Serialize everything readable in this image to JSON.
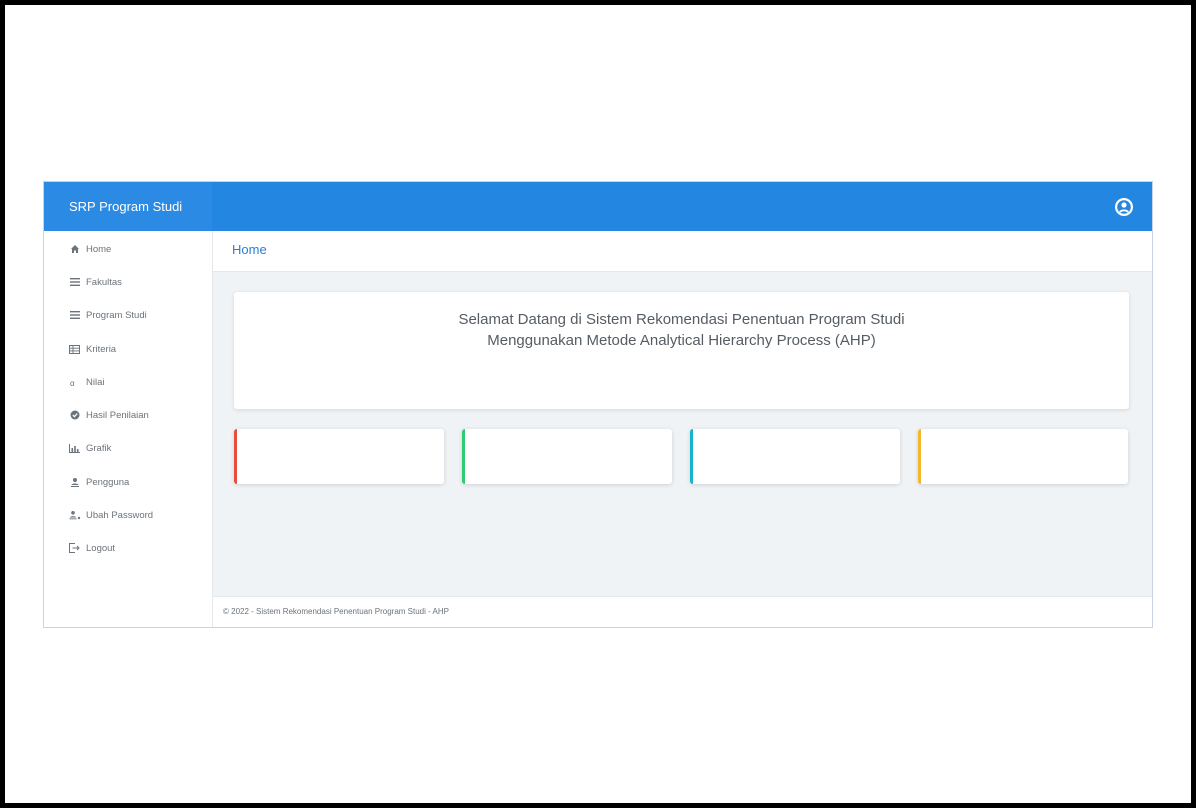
{
  "app": {
    "brand": "SRP Program Studi"
  },
  "sidebar": {
    "items": [
      {
        "label": "Home",
        "icon": "home-icon"
      },
      {
        "label": "Fakultas",
        "icon": "list-icon"
      },
      {
        "label": "Program Studi",
        "icon": "list-icon"
      },
      {
        "label": "Kriteria",
        "icon": "table-icon"
      },
      {
        "label": "Nilai",
        "icon": "sort-icon"
      },
      {
        "label": "Hasil Penilaian",
        "icon": "check-circle-icon"
      },
      {
        "label": "Grafik",
        "icon": "bar-chart-icon"
      },
      {
        "label": "Pengguna",
        "icon": "user-icon"
      },
      {
        "label": "Ubah Password",
        "icon": "user-key-icon"
      },
      {
        "label": "Logout",
        "icon": "logout-icon"
      }
    ]
  },
  "breadcrumb": {
    "current": "Home"
  },
  "welcome": {
    "line1": "Selamat Datang di Sistem Rekomendasi Penentuan Program Studi",
    "line2": "Menggunakan Metode Analytical Hierarchy Process (AHP)"
  },
  "stat_cards": [
    {
      "accent": "#e74c3c"
    },
    {
      "accent": "#2ecc71"
    },
    {
      "accent": "#17b2cc"
    },
    {
      "accent": "#f1b82d"
    }
  ],
  "footer": {
    "text": "© 2022 - Sistem Rekomendasi Penentuan Program Studi - AHP"
  },
  "colors": {
    "topbar": "#2386e0",
    "brand_bg": "#2b8ae4",
    "breadcrumb_text": "#2a7fd4",
    "content_bg": "#f0f3f5"
  }
}
